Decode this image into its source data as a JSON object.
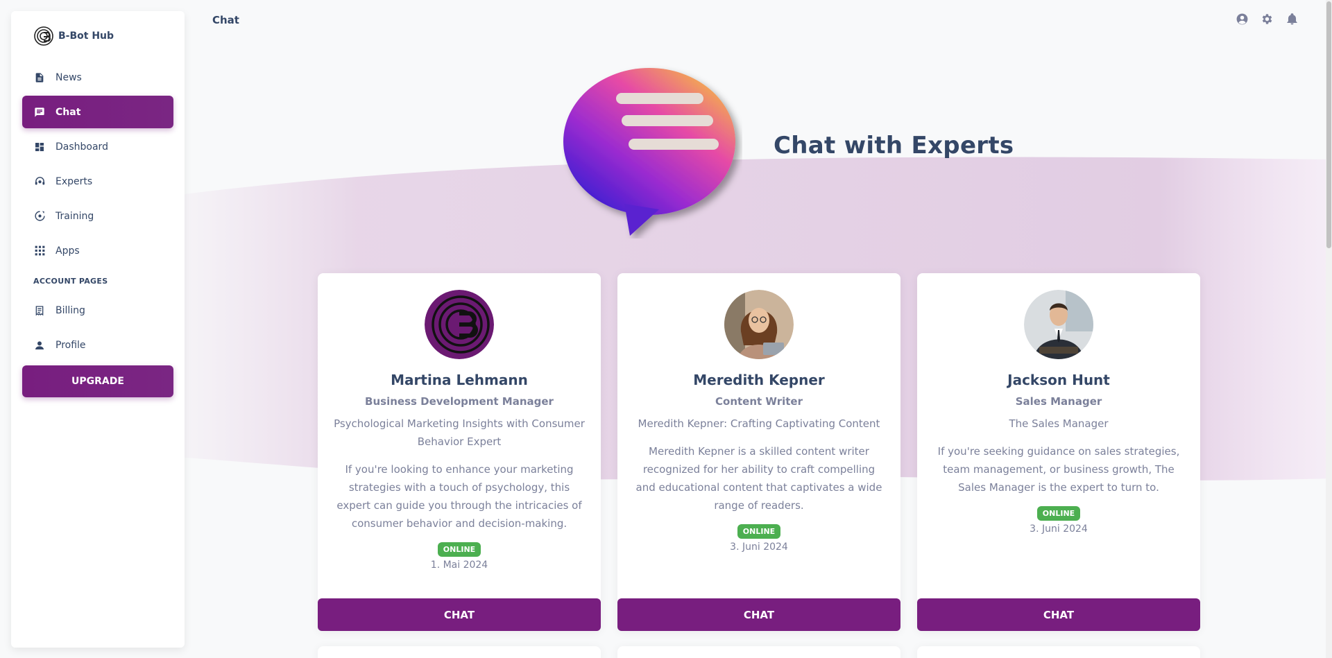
{
  "brand": {
    "name": "B-Bot Hub",
    "logo_icon": "b-bot-logo-icon"
  },
  "sidebar": {
    "items": [
      {
        "label": "News",
        "icon": "article-icon",
        "active": false
      },
      {
        "label": "Chat",
        "icon": "chat-icon",
        "active": true
      },
      {
        "label": "Dashboard",
        "icon": "dashboard-icon",
        "active": false
      },
      {
        "label": "Experts",
        "icon": "support-agent-icon",
        "active": false
      },
      {
        "label": "Training",
        "icon": "training-icon",
        "active": false
      },
      {
        "label": "Apps",
        "icon": "apps-grid-icon",
        "active": false
      }
    ],
    "section_label": "ACCOUNT PAGES",
    "account_items": [
      {
        "label": "Billing",
        "icon": "receipt-icon"
      },
      {
        "label": "Profile",
        "icon": "person-icon"
      }
    ],
    "upgrade_label": "UPGRADE"
  },
  "topbar": {
    "title": "Chat",
    "icons": [
      "account-circle-icon",
      "settings-gear-icon",
      "notifications-bell-icon"
    ]
  },
  "hero": {
    "title": "Chat with Experts",
    "image": "chat-bubble-illustration"
  },
  "cards": [
    {
      "name": "Martina Lehmann",
      "role": "Business Development Manager",
      "headline": "Psychological Marketing Insights with Consumer Behavior Expert",
      "description": "If you're looking to enhance your marketing strategies with a touch of psychology, this expert can guide you through the intricacies of consumer behavior and decision-making.",
      "status": "ONLINE",
      "date": "1. Mai 2024",
      "button": "CHAT"
    },
    {
      "name": "Meredith Kepner",
      "role": "Content Writer",
      "headline": "Meredith Kepner: Crafting Captivating Content",
      "description": "Meredith Kepner is a skilled content writer recognized for her ability to craft compelling and educational content that captivates a wide range of readers.",
      "status": "ONLINE",
      "date": "3. Juni 2024",
      "button": "CHAT"
    },
    {
      "name": "Jackson Hunt",
      "role": "Sales Manager",
      "headline": "The Sales Manager",
      "description": "If you're seeking guidance on sales strategies, team management, or business growth, The Sales Manager is the expert to turn to.",
      "status": "ONLINE",
      "date": "3. Juni 2024",
      "button": "CHAT"
    }
  ],
  "colors": {
    "primary": "#781e7f",
    "online": "#4caf50",
    "text": "#344767",
    "muted": "#7b809a"
  }
}
